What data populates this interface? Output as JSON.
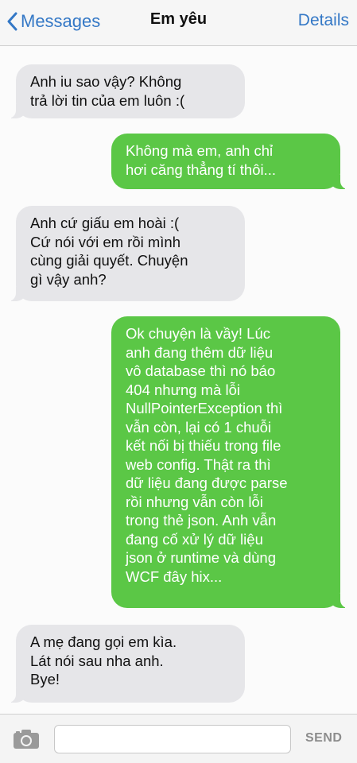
{
  "nav": {
    "back_label": "Messages",
    "title": "Em yêu",
    "details_label": "Details"
  },
  "messages": [
    {
      "direction": "incoming",
      "text": "Anh iu sao vậy? Không\ntrả lời tin của em luôn :("
    },
    {
      "direction": "outgoing",
      "text": "Không mà em, anh chỉ\nhơi căng thẳng tí thôi..."
    },
    {
      "direction": "incoming",
      "text": "Anh cứ giấu em hoài :(\nCứ nói với em rồi mình\ncùng giải quyết. Chuyện\ngì vậy anh?"
    },
    {
      "direction": "outgoing",
      "text": "Ok chuyện là vầy! Lúc\nanh đang thêm dữ liệu\nvô database thì nó báo\n404 nhưng mà lỗi\nNullPointerException thì\nvẫn còn, lại có 1 chuỗi\nkết nối bị thiếu trong file\nweb config. Thật ra thì\ndữ liệu đang được parse\nrồi nhưng vẫn còn lỗi\ntrong thẻ json. Anh vẫn\nđang cố xử lý dữ liệu\njson ở runtime và dùng\nWCF đây hix..."
    },
    {
      "direction": "incoming",
      "text": "A mẹ đang gọi em kìa.\nLát nói sau nha anh.\nBye!"
    }
  ],
  "composer": {
    "input_value": "",
    "send_label": "SEND",
    "camera_icon": "camera-icon"
  },
  "colors": {
    "accent": "#3478c6",
    "incoming_bubble": "#e6e6e9",
    "outgoing_bubble": "#5bc746"
  }
}
